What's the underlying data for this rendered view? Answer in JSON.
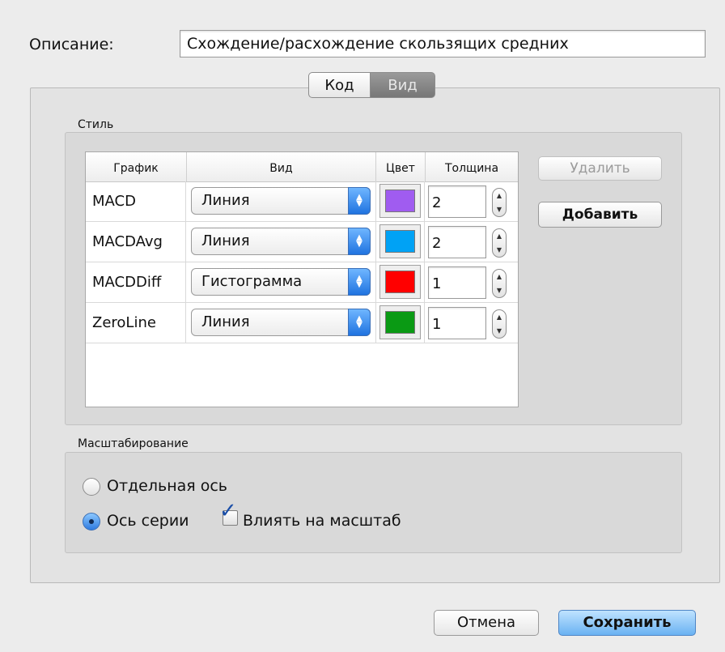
{
  "description": {
    "label": "Описание:",
    "value": "Схождение/расхождение скользящих средних"
  },
  "tabs": [
    {
      "label": "Код",
      "selected": false
    },
    {
      "label": "Вид",
      "selected": true
    }
  ],
  "style_section": {
    "title": "Стиль",
    "columns": [
      "График",
      "Вид",
      "Цвет",
      "Толщина"
    ],
    "rows": [
      {
        "name": "MACD",
        "type": "Линия",
        "color": "#a05cf0",
        "thickness": "2"
      },
      {
        "name": "MACDAvg",
        "type": "Линия",
        "color": "#00a2f5",
        "thickness": "2"
      },
      {
        "name": "MACDDiff",
        "type": "Гистограмма",
        "color": "#ff0000",
        "thickness": "1"
      },
      {
        "name": "ZeroLine",
        "type": "Линия",
        "color": "#0a9a14",
        "thickness": "1"
      }
    ],
    "delete_label": "Удалить",
    "add_label": "Добавить"
  },
  "scaling_section": {
    "title": "Масштабирование",
    "separate_axis_label": "Отдельная ось",
    "series_axis_label": "Ось серии",
    "affect_scale_label": "Влиять на масштаб",
    "selected": "series_axis",
    "affect_scale_checked": true
  },
  "footer": {
    "cancel_label": "Отмена",
    "save_label": "Сохранить"
  }
}
